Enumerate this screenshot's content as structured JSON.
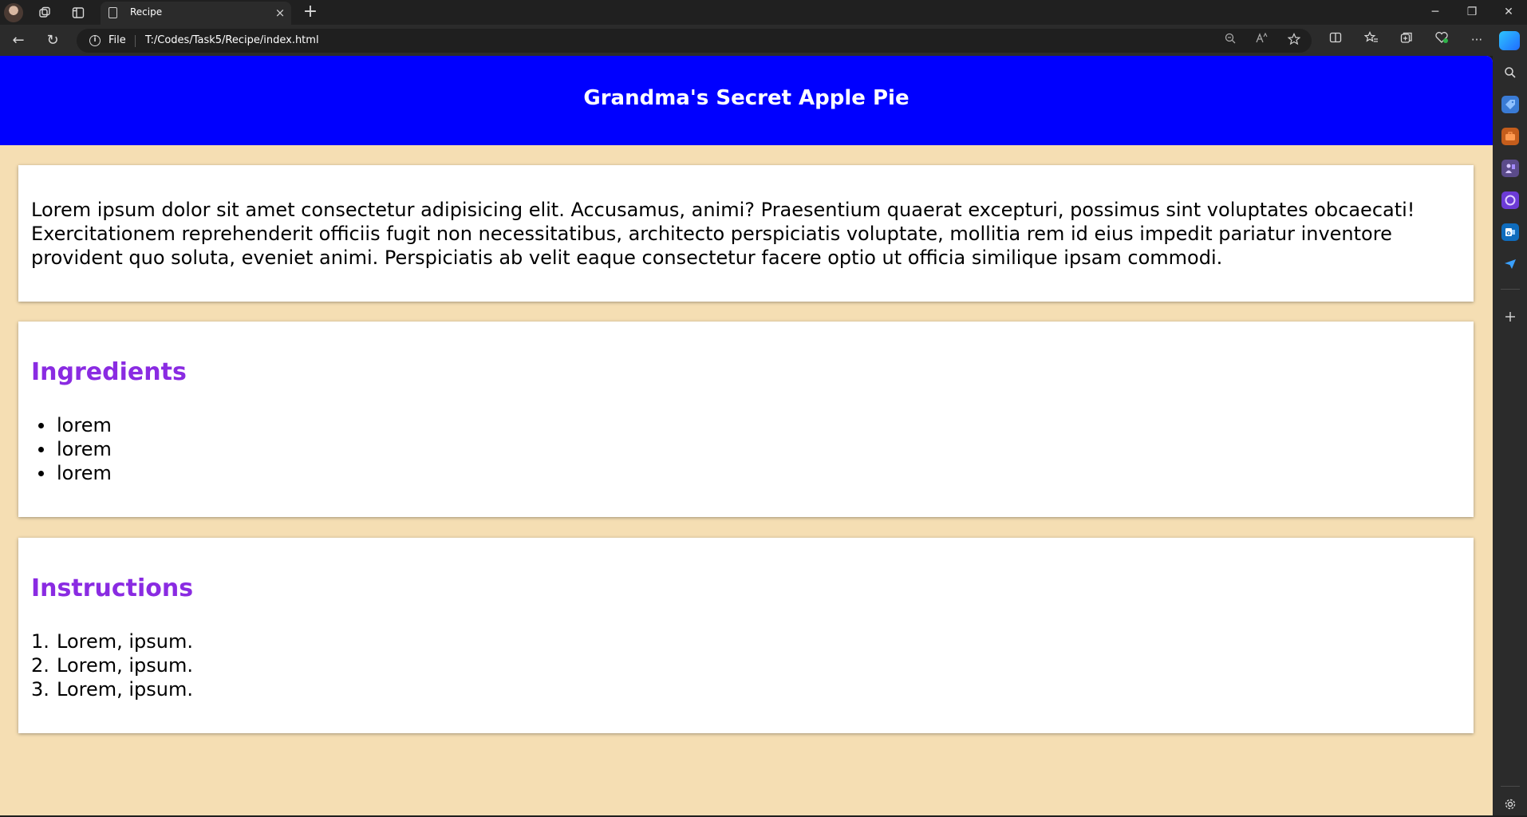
{
  "browser": {
    "tab_title": "Recipe",
    "tab_close": "×",
    "new_tab": "+",
    "window_controls": {
      "minimize": "─",
      "restore": "❐",
      "close": "✕"
    },
    "address": {
      "scheme_label": "File",
      "url": "T:/Codes/Task5/Recipe/index.html"
    },
    "nav": {
      "back": "←",
      "reload": "↻"
    },
    "toolbar_glyphs": {
      "more": "···"
    }
  },
  "page": {
    "title": "Grandma's Secret Apple Pie",
    "intro": "Lorem ipsum dolor sit amet consectetur adipisicing elit. Accusamus, animi? Praesentium quaerat excepturi, possimus sint voluptates obcaecati! Exercitationem reprehenderit officiis fugit non necessitatibus, architecto perspiciatis voluptate, mollitia rem id eius impedit pariatur inventore provident quo soluta, eveniet animi. Perspiciatis ab velit eaque consectetur facere optio ut officia similique ipsam commodi.",
    "ingredients": {
      "heading": "Ingredients",
      "items": [
        "lorem",
        "lorem",
        "lorem"
      ]
    },
    "instructions": {
      "heading": "Instructions",
      "steps": [
        {
          "num": "1.",
          "text": "Lorem, ipsum."
        },
        {
          "num": "2.",
          "text": "Lorem, ipsum."
        },
        {
          "num": "3.",
          "text": "Lorem, ipsum."
        }
      ]
    }
  },
  "colors": {
    "header_bg": "#0000ff",
    "page_bg": "#f5deb3",
    "heading": "#8a2be2"
  }
}
